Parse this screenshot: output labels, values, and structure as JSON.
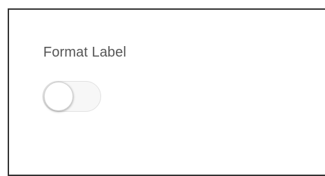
{
  "panel": {
    "label": "Format Label",
    "toggle": {
      "state": "off",
      "checked": false
    }
  },
  "colors": {
    "border": "#333333",
    "label_text": "#555555",
    "toggle_track": "#f7f7f7",
    "toggle_knob": "#ffffff"
  }
}
